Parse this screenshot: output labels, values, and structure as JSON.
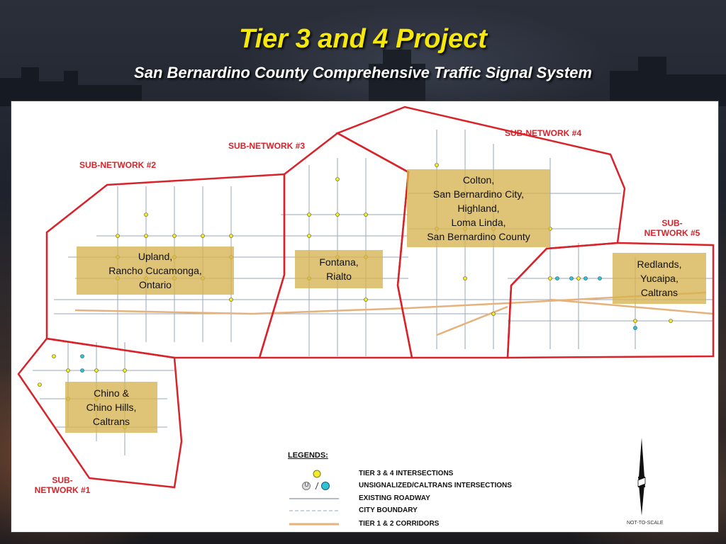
{
  "title": "Tier 3 and 4 Project",
  "subtitle": "San Bernardino County Comprehensive Traffic Signal System",
  "subnetworks": {
    "sn1": [
      "SUB-",
      "NETWORK #1"
    ],
    "sn2": "SUB-NETWORK #2",
    "sn3": "SUB-NETWORK #3",
    "sn4": "SUB-NETWORK #4",
    "sn5": [
      "SUB-",
      "NETWORK #5"
    ]
  },
  "areas": {
    "upland": [
      "Upland,",
      "Rancho Cucamonga,",
      "Ontario"
    ],
    "fontana": [
      "Fontana,",
      "Rialto"
    ],
    "colton": [
      "Colton,",
      "San Bernardino City,",
      "Highland,",
      "Loma Linda,",
      "San Bernardino County"
    ],
    "redlands": [
      "Redlands,",
      "Yucaipa,",
      "Caltrans"
    ],
    "chino": [
      "Chino &",
      "Chino Hills,",
      "Caltrans"
    ]
  },
  "legend": {
    "title": "LEGENDS:",
    "items": [
      "TIER 3 & 4 INTERSECTIONS",
      "UNSIGNALIZED/CALTRANS INTERSECTIONS",
      "EXISTING ROADWAY",
      "CITY BOUNDARY",
      "TIER 1 & 2 CORRIDORS"
    ],
    "unsignalized_symbol": "U"
  },
  "scale_note": "NOT-TO-SCALE",
  "colors": {
    "subnetwork_boundary": "#d8232a",
    "intersection": "#f2ea2a",
    "caltrans_intersection": "#2ec3d6",
    "area_label_fill": "#d6b250",
    "title_text": "#f6e80c"
  }
}
